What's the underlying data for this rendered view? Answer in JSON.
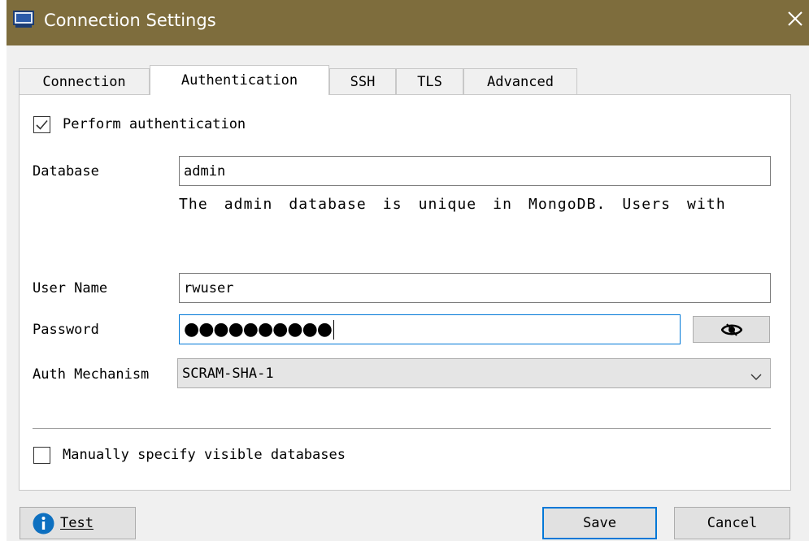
{
  "window": {
    "title": "Connection Settings",
    "icon": "window-app-icon",
    "close_icon": "close-icon"
  },
  "tabs": [
    {
      "label": "Connection",
      "active": false
    },
    {
      "label": "Authentication",
      "active": true
    },
    {
      "label": "SSH",
      "active": false
    },
    {
      "label": "TLS",
      "active": false
    },
    {
      "label": "Advanced",
      "active": false
    }
  ],
  "auth": {
    "perform_label": "Perform authentication",
    "perform_checked": true,
    "database_label": "Database",
    "database_value": "admin",
    "database_help": "The admin database is unique in MongoDB. Users with normal access to the admin database have read and write",
    "username_label": "User Name",
    "username_value": "rwuser",
    "password_label": "Password",
    "password_masked": "●●●●●●●●●●",
    "show_password_icon": "eye-icon",
    "mechanism_label": "Auth Mechanism",
    "mechanism_value": "SCRAM-SHA-1",
    "manual_label": "Manually specify visible databases",
    "manual_checked": false
  },
  "buttons": {
    "test_label": "Test",
    "test_icon": "info-icon",
    "save_label": "Save",
    "cancel_label": "Cancel"
  },
  "colors": {
    "titlebar": "#7e6d3d",
    "focus": "#0078d7",
    "info": "#0e70c0"
  }
}
